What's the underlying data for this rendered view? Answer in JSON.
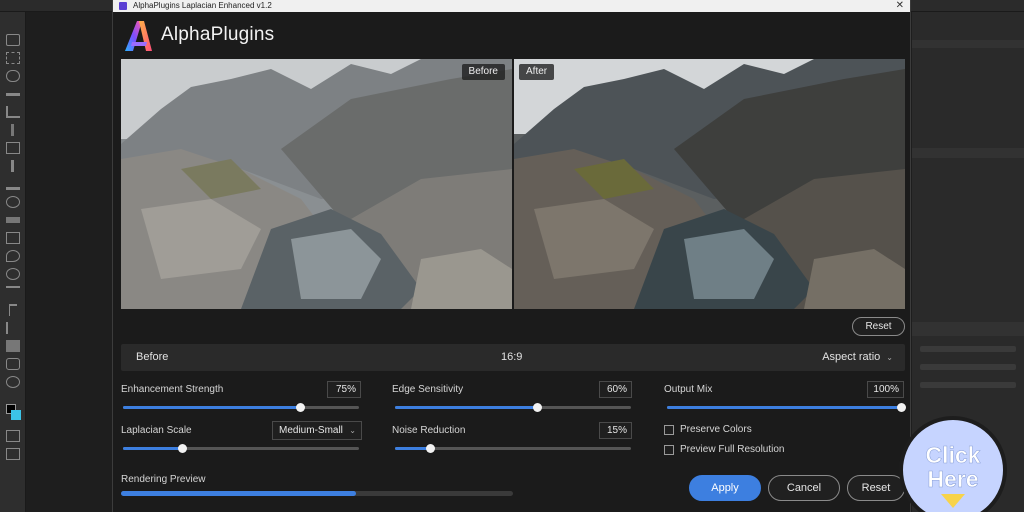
{
  "window": {
    "title": "AlphaPlugins Laplacian Enhanced v1.2",
    "brand": "AlphaPlugins"
  },
  "preview": {
    "before_tag": "Before",
    "after_tag": "After",
    "reset_label": "Reset"
  },
  "infobar": {
    "left_label": "Before",
    "ratio": "16:9",
    "aspect_label": "Aspect ratio"
  },
  "controls": {
    "enhancement_strength": {
      "label": "Enhancement Strength",
      "value": "75%",
      "level": 0.75
    },
    "edge_sensitivity": {
      "label": "Edge Sensitivity",
      "value": "60%",
      "level": 0.6
    },
    "output_mix": {
      "label": "Output Mix",
      "value": "100%",
      "level": 1.0
    },
    "laplacian_scale": {
      "label": "Laplacian Scale",
      "value": "Medium-Small",
      "level": 0.25
    },
    "noise_reduction": {
      "label": "Noise Reduction",
      "value": "15%",
      "level": 0.15
    },
    "preserve_colors": {
      "label": "Preserve Colors",
      "checked": false
    },
    "preview_full_resolution": {
      "label": "Preview Full Resolution",
      "checked": false
    }
  },
  "rendering": {
    "label": "Rendering Preview",
    "progress": 0.6
  },
  "buttons": {
    "apply": "Apply",
    "cancel": "Cancel",
    "reset": "Reset"
  },
  "badge": {
    "line1": "Click",
    "line2": "Here"
  },
  "colors": {
    "accent": "#3d7fe0",
    "badge": "#c6d4ff",
    "arrow": "#f7d34a"
  },
  "icons": [
    "window-app-icon",
    "close-icon",
    "alphaplugins-logo-icon",
    "chevron-down-icon",
    "select-caret-icon",
    "arrow-down-icon"
  ]
}
